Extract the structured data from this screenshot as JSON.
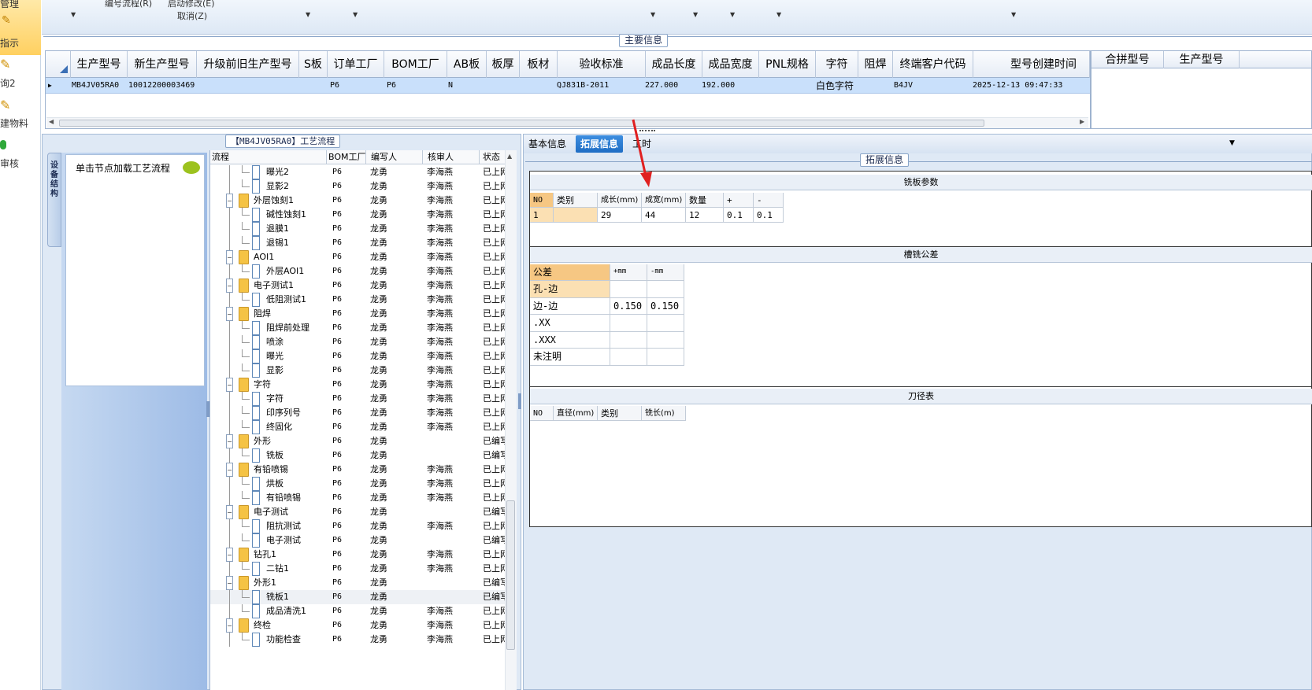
{
  "nav": {
    "items": [
      "管理",
      "指示",
      "询2",
      "建物料",
      "审核"
    ]
  },
  "toolbar": {
    "item1": "编号流程(R)",
    "item2": "启动修改(E)",
    "item3": "取消(Z)"
  },
  "main": {
    "section_title": "主要信息",
    "columns": [
      "生产型号",
      "新生产型号",
      "升级前旧生产型号",
      "S板",
      "订单工厂",
      "BOM工厂",
      "AB板",
      "板厚",
      "板材",
      "验收标准",
      "成品长度",
      "成品宽度",
      "PNL规格",
      "字符",
      "阻焊",
      "终端客户代码",
      "型号创建时间"
    ],
    "row": {
      "production_model": "MB4JV05RA0",
      "new_model": "10012200003469",
      "order_factory": "P6",
      "bom_factory": "P6",
      "ab": "N",
      "standard": "QJ831B-2011",
      "length": "227.000",
      "width": "192.000",
      "char": "白色字符",
      "customer": "B4JV",
      "created": "2025-12-13 09:47:33"
    },
    "right_columns": [
      "合拼型号",
      "生产型号"
    ]
  },
  "process": {
    "title": "【MB4JV05RA0】工艺流程",
    "side_tab": "设备结构",
    "load_hint": "单击节点加载工艺流程",
    "columns": [
      "流程",
      "BOM工厂",
      "编写人",
      "核审人",
      "状态"
    ],
    "rows": [
      {
        "name": "曝光2",
        "level": 2,
        "factory": "P6",
        "writer": "龙勇",
        "reviewer": "李海燕",
        "status": "已上网"
      },
      {
        "name": "显影2",
        "level": 2,
        "factory": "P6",
        "writer": "龙勇",
        "reviewer": "李海燕",
        "status": "已上网"
      },
      {
        "name": "外层蚀刻1",
        "level": 1,
        "factory": "P6",
        "writer": "龙勇",
        "reviewer": "李海燕",
        "status": "已上网"
      },
      {
        "name": "碱性蚀刻1",
        "level": 2,
        "factory": "P6",
        "writer": "龙勇",
        "reviewer": "李海燕",
        "status": "已上网"
      },
      {
        "name": "退膜1",
        "level": 2,
        "factory": "P6",
        "writer": "龙勇",
        "reviewer": "李海燕",
        "status": "已上网"
      },
      {
        "name": "退锡1",
        "level": 2,
        "factory": "P6",
        "writer": "龙勇",
        "reviewer": "李海燕",
        "status": "已上网"
      },
      {
        "name": "AOI1",
        "level": 1,
        "factory": "P6",
        "writer": "龙勇",
        "reviewer": "李海燕",
        "status": "已上网"
      },
      {
        "name": "外层AOI1",
        "level": 2,
        "factory": "P6",
        "writer": "龙勇",
        "reviewer": "李海燕",
        "status": "已上网"
      },
      {
        "name": "电子测试1",
        "level": 1,
        "factory": "P6",
        "writer": "龙勇",
        "reviewer": "李海燕",
        "status": "已上网"
      },
      {
        "name": "低阻测试1",
        "level": 2,
        "factory": "P6",
        "writer": "龙勇",
        "reviewer": "李海燕",
        "status": "已上网"
      },
      {
        "name": "阻焊",
        "level": 1,
        "factory": "P6",
        "writer": "龙勇",
        "reviewer": "李海燕",
        "status": "已上网"
      },
      {
        "name": "阻焊前处理",
        "level": 2,
        "factory": "P6",
        "writer": "龙勇",
        "reviewer": "李海燕",
        "status": "已上网"
      },
      {
        "name": "喷涂",
        "level": 2,
        "factory": "P6",
        "writer": "龙勇",
        "reviewer": "李海燕",
        "status": "已上网"
      },
      {
        "name": "曝光",
        "level": 2,
        "factory": "P6",
        "writer": "龙勇",
        "reviewer": "李海燕",
        "status": "已上网"
      },
      {
        "name": "显影",
        "level": 2,
        "factory": "P6",
        "writer": "龙勇",
        "reviewer": "李海燕",
        "status": "已上网"
      },
      {
        "name": "字符",
        "level": 1,
        "factory": "P6",
        "writer": "龙勇",
        "reviewer": "李海燕",
        "status": "已上网"
      },
      {
        "name": "字符",
        "level": 2,
        "factory": "P6",
        "writer": "龙勇",
        "reviewer": "李海燕",
        "status": "已上网"
      },
      {
        "name": "印序列号",
        "level": 2,
        "factory": "P6",
        "writer": "龙勇",
        "reviewer": "李海燕",
        "status": "已上网"
      },
      {
        "name": "终固化",
        "level": 2,
        "factory": "P6",
        "writer": "龙勇",
        "reviewer": "李海燕",
        "status": "已上网"
      },
      {
        "name": "外形",
        "level": 1,
        "factory": "P6",
        "writer": "龙勇",
        "reviewer": "",
        "status": "已编写"
      },
      {
        "name": "铣板",
        "level": 2,
        "factory": "P6",
        "writer": "龙勇",
        "reviewer": "",
        "status": "已编写"
      },
      {
        "name": "有铅喷锡",
        "level": 1,
        "factory": "P6",
        "writer": "龙勇",
        "reviewer": "李海燕",
        "status": "已上网"
      },
      {
        "name": "烘板",
        "level": 2,
        "factory": "P6",
        "writer": "龙勇",
        "reviewer": "李海燕",
        "status": "已上网"
      },
      {
        "name": "有铅喷锡",
        "level": 2,
        "factory": "P6",
        "writer": "龙勇",
        "reviewer": "李海燕",
        "status": "已上网"
      },
      {
        "name": "电子测试",
        "level": 1,
        "factory": "P6",
        "writer": "龙勇",
        "reviewer": "",
        "status": "已编写"
      },
      {
        "name": "阻抗测试",
        "level": 2,
        "factory": "P6",
        "writer": "龙勇",
        "reviewer": "李海燕",
        "status": "已上网"
      },
      {
        "name": "电子测试",
        "level": 2,
        "factory": "P6",
        "writer": "龙勇",
        "reviewer": "",
        "status": "已编写"
      },
      {
        "name": "钻孔1",
        "level": 1,
        "factory": "P6",
        "writer": "龙勇",
        "reviewer": "李海燕",
        "status": "已上网"
      },
      {
        "name": "二钻1",
        "level": 2,
        "factory": "P6",
        "writer": "龙勇",
        "reviewer": "李海燕",
        "status": "已上网"
      },
      {
        "name": "外形1",
        "level": 1,
        "factory": "P6",
        "writer": "龙勇",
        "reviewer": "",
        "status": "已编写"
      },
      {
        "name": "铣板1",
        "level": 2,
        "factory": "P6",
        "writer": "龙勇",
        "reviewer": "",
        "status": "已编写"
      },
      {
        "name": "成品清洗1",
        "level": 2,
        "factory": "P6",
        "writer": "龙勇",
        "reviewer": "李海燕",
        "status": "已上网"
      },
      {
        "name": "终检",
        "level": 1,
        "factory": "P6",
        "writer": "龙勇",
        "reviewer": "李海燕",
        "status": "已上网"
      },
      {
        "name": "功能检查",
        "level": 2,
        "factory": "P6",
        "writer": "龙勇",
        "reviewer": "李海燕",
        "status": "已上网"
      }
    ]
  },
  "ext": {
    "tabs": [
      "基本信息",
      "拓展信息",
      "工时"
    ],
    "section_title": "拓展信息",
    "milling": {
      "title": "铣板参数",
      "columns": [
        "NO",
        "类别",
        "成长(mm)",
        "成宽(mm)",
        "数量",
        "+",
        "-"
      ],
      "row": [
        "1",
        "",
        "29",
        "44",
        "12",
        "0.1",
        "0.1"
      ]
    },
    "tolerance": {
      "title": "槽铣公差",
      "columns": [
        "公差",
        "+mm",
        "-mm"
      ],
      "rows": [
        [
          "孔-边",
          "",
          ""
        ],
        [
          "边-边",
          "0.150",
          "0.150"
        ],
        [
          ".XX",
          "",
          ""
        ],
        [
          ".XXX",
          "",
          ""
        ],
        [
          "未注明",
          "",
          ""
        ]
      ]
    },
    "cutter": {
      "title": "刀径表",
      "columns": [
        "NO",
        "直径(mm)",
        "类别",
        "铣长(m)"
      ]
    }
  },
  "colors": {
    "accent": "#1e6dc4",
    "selected_row": "#c9e0fb",
    "highlight": "#f6c783",
    "arrow": "#e02020"
  }
}
